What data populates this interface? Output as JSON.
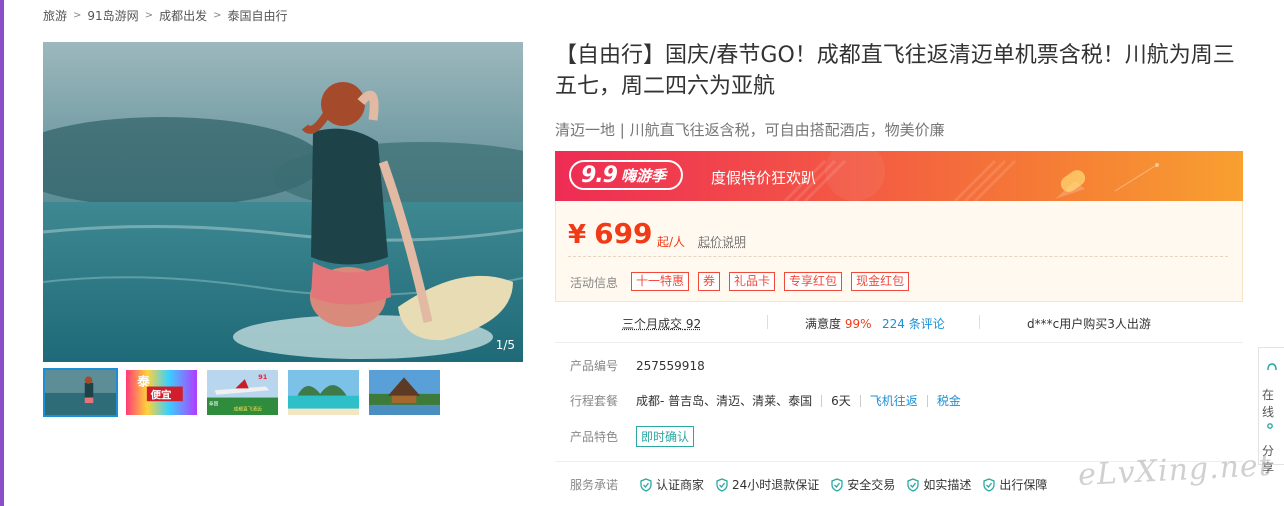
{
  "breadcrumb": [
    "旅游",
    "91岛游网",
    "成都出发",
    "泰国自由行"
  ],
  "gallery": {
    "counter": "1/5",
    "thumbnails": [
      {
        "name": "surfer-thumb"
      },
      {
        "name": "thai-promo-thumb",
        "text1": "泰",
        "text2": "便宜"
      },
      {
        "name": "airplane-thumb",
        "text1": "泰国",
        "text2": "成都直飞清迈",
        "logo": "91"
      },
      {
        "name": "beach-thumb"
      },
      {
        "name": "temple-thumb"
      }
    ]
  },
  "product": {
    "title": "【自由行】国庆/春节GO！成都直飞往返清迈单机票含税！川航为周三五七，周二四六为亚航",
    "subtitle": "清迈一地 | 川航直飞往返含税，可自由搭配酒店，物美价廉"
  },
  "promo": {
    "big": "9.9",
    "small": "嗨游季",
    "text": "度假特价狂欢趴"
  },
  "price": {
    "currency": "¥",
    "amount": "699",
    "unit": "起/人",
    "explain": "起价说明",
    "activity_label": "活动信息",
    "tags": [
      "十一特惠",
      "券",
      "礼品卡",
      "专享红包",
      "现金红包"
    ]
  },
  "stats": {
    "sales_label": "三个月成交",
    "sales_count": "92",
    "satisfaction_label": "满意度",
    "satisfaction_value": "99%",
    "reviews": "224 条评论",
    "recent_buy": "d***c用户购买3人出游"
  },
  "info": {
    "id_label": "产品编号",
    "id_value": "257559918",
    "route_label": "行程套餐",
    "route_value": "成都- 普吉岛、清迈、清莱、泰国",
    "days": "6天",
    "flight": "飞机往返",
    "tax": "税金",
    "feature_label": "产品特色",
    "feature_value": "即时确认"
  },
  "promise": {
    "label": "服务承诺",
    "items": [
      "认证商家",
      "24小时退款保证",
      "安全交易",
      "如实描述",
      "出行保障"
    ]
  },
  "side_tools": [
    "在线",
    "分享"
  ],
  "watermark": "eLvXing.net",
  "colors": {
    "accent_red": "#f13a16",
    "link_blue": "#1b8fd6",
    "teal": "#2aa9a0",
    "promo_start": "#ee2c54",
    "promo_end": "#f8a030"
  }
}
